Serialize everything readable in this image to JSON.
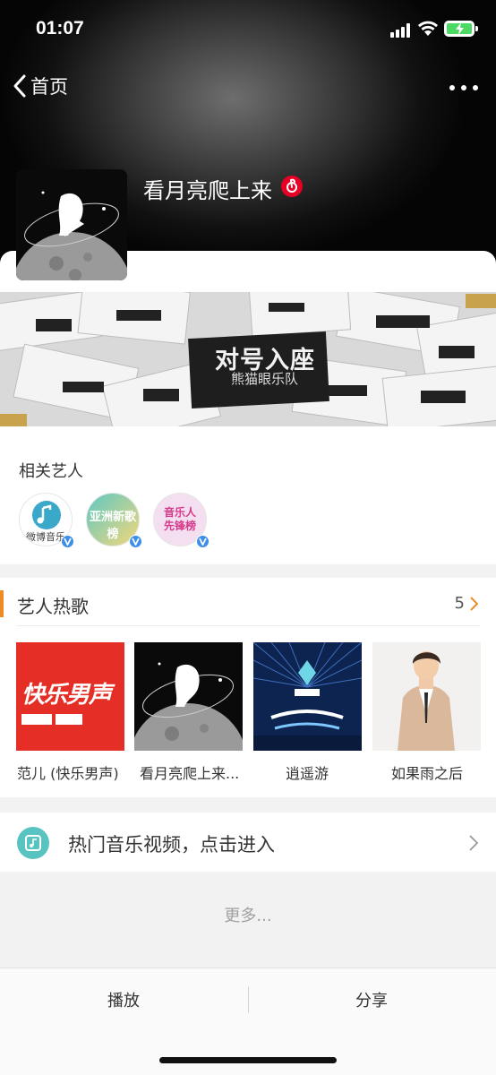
{
  "status_bar": {
    "time": "01:07"
  },
  "nav": {
    "back_label": "首页"
  },
  "song": {
    "title": "看月亮爬上来"
  },
  "banner": {
    "title": "对号入座",
    "subtitle": "熊猫眼乐队"
  },
  "related_artists": {
    "label": "相关艺人",
    "items": [
      {
        "name": "微博音乐",
        "bg": "#ffffff",
        "color": "#444444"
      },
      {
        "name": "亚洲新歌榜",
        "bg": "#8fd3e0",
        "color": "#ffffff"
      },
      {
        "name": "音乐人先锋榜",
        "bg": "#f1d9ef",
        "color": "#d63a8c"
      }
    ]
  },
  "hot_songs": {
    "title": "艺人热歌",
    "count": "5",
    "items": [
      {
        "name": "范儿 (快乐男声)",
        "cover_text": "快乐男声"
      },
      {
        "name": "看月亮爬上来..."
      },
      {
        "name": "逍遥游"
      },
      {
        "name": "如果雨之后"
      }
    ]
  },
  "videos": {
    "label": "热门音乐视频，点击进入"
  },
  "more": {
    "label": "更多..."
  },
  "bottom_bar": {
    "play_label": "播放",
    "share_label": "分享"
  },
  "colors": {
    "accent": "#f08a24",
    "netease": "#e60026",
    "verified": "#3c8ee8",
    "video_icon": "#58c3c0"
  }
}
